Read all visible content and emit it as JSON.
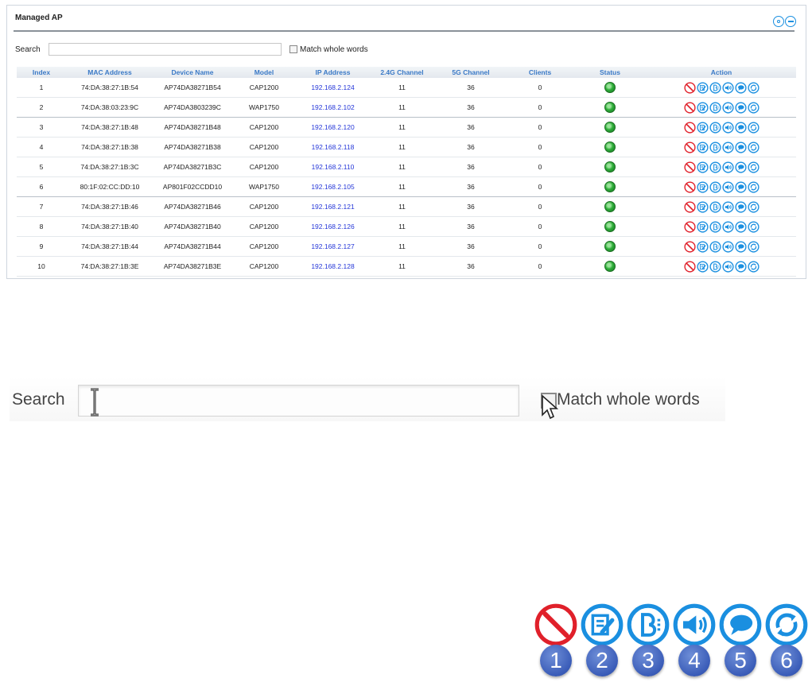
{
  "panel": {
    "title": "Managed AP",
    "search_label": "Search",
    "search_value": "",
    "match_whole_words_label": "Match whole words",
    "match_whole_words_checked": false
  },
  "table": {
    "headers": [
      "Index",
      "MAC Address",
      "Device Name",
      "Model",
      "IP Address",
      "2.4G Channel",
      "5G Channel",
      "Clients",
      "Status",
      "Action"
    ],
    "rows": [
      {
        "index": "1",
        "mac": "74:DA:38:27:1B:54",
        "device": "AP74DA38271B54",
        "model": "CAP1200",
        "ip": "192.168.2.124",
        "ch24": "11",
        "ch5": "36",
        "clients": "0",
        "status": "online"
      },
      {
        "index": "2",
        "mac": "74:DA:38:03:23:9C",
        "device": "AP74DA3803239C",
        "model": "WAP1750",
        "ip": "192.168.2.102",
        "ch24": "11",
        "ch5": "36",
        "clients": "0",
        "status": "online"
      },
      {
        "index": "3",
        "mac": "74:DA:38:27:1B:48",
        "device": "AP74DA38271B48",
        "model": "CAP1200",
        "ip": "192.168.2.120",
        "ch24": "11",
        "ch5": "36",
        "clients": "0",
        "status": "online"
      },
      {
        "index": "4",
        "mac": "74:DA:38:27:1B:38",
        "device": "AP74DA38271B38",
        "model": "CAP1200",
        "ip": "192.168.2.118",
        "ch24": "11",
        "ch5": "36",
        "clients": "0",
        "status": "online"
      },
      {
        "index": "5",
        "mac": "74:DA:38:27:1B:3C",
        "device": "AP74DA38271B3C",
        "model": "CAP1200",
        "ip": "192.168.2.110",
        "ch24": "11",
        "ch5": "36",
        "clients": "0",
        "status": "online"
      },
      {
        "index": "6",
        "mac": "80:1F:02:CC:DD:10",
        "device": "AP801F02CCDD10",
        "model": "WAP1750",
        "ip": "192.168.2.105",
        "ch24": "11",
        "ch5": "36",
        "clients": "0",
        "status": "online"
      },
      {
        "index": "7",
        "mac": "74:DA:38:27:1B:46",
        "device": "AP74DA38271B46",
        "model": "CAP1200",
        "ip": "192.168.2.121",
        "ch24": "11",
        "ch5": "36",
        "clients": "0",
        "status": "online"
      },
      {
        "index": "8",
        "mac": "74:DA:38:27:1B:40",
        "device": "AP74DA38271B40",
        "model": "CAP1200",
        "ip": "192.168.2.126",
        "ch24": "11",
        "ch5": "36",
        "clients": "0",
        "status": "online"
      },
      {
        "index": "9",
        "mac": "74:DA:38:27:1B:44",
        "device": "AP74DA38271B44",
        "model": "CAP1200",
        "ip": "192.168.2.127",
        "ch24": "11",
        "ch5": "36",
        "clients": "0",
        "status": "online"
      },
      {
        "index": "10",
        "mac": "74:DA:38:27:1B:3E",
        "device": "AP74DA38271B3E",
        "model": "CAP1200",
        "ip": "192.168.2.128",
        "ch24": "11",
        "ch5": "36",
        "clients": "0",
        "status": "online"
      }
    ],
    "action_icons": [
      "block-icon",
      "edit-icon",
      "bandsteering-icon",
      "volume-icon",
      "chat-icon",
      "refresh-icon"
    ]
  },
  "zoom": {
    "search_label": "Search",
    "match_whole_words_label": "Match whole words"
  },
  "legend": {
    "items": [
      {
        "icon": "block-icon",
        "number": "1"
      },
      {
        "icon": "edit-icon",
        "number": "2"
      },
      {
        "icon": "bandsteering-icon",
        "number": "3"
      },
      {
        "icon": "volume-icon",
        "number": "4"
      },
      {
        "icon": "chat-icon",
        "number": "5"
      },
      {
        "icon": "refresh-icon",
        "number": "6"
      }
    ]
  },
  "colors": {
    "header_text": "#3a79c6",
    "ip_link": "#2436d8",
    "action_blue": "#1a8fe0",
    "block_red": "#e0202a",
    "status_green": "#2fae3a",
    "legend_badge": "#3a5cb8"
  }
}
